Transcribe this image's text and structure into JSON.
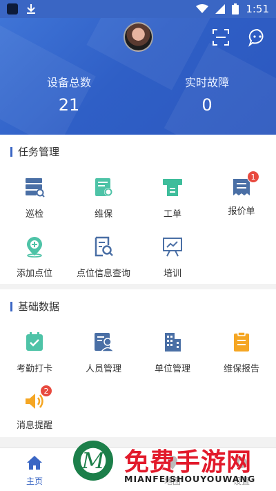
{
  "status_bar": {
    "time": "1:51"
  },
  "header": {
    "stats": [
      {
        "label": "设备总数",
        "value": "21"
      },
      {
        "label": "实时故障",
        "value": "0"
      }
    ]
  },
  "sections": {
    "tasks": {
      "title": "任务管理",
      "items": [
        {
          "label": "巡检",
          "icon": "inspection-icon",
          "color": "#4a6fa5"
        },
        {
          "label": "维保",
          "icon": "maintenance-icon",
          "color": "#4ec3a7"
        },
        {
          "label": "工单",
          "icon": "work-order-icon",
          "color": "#3ebd9b"
        },
        {
          "label": "报价单",
          "icon": "quotation-icon",
          "color": "#4a6fa5",
          "badge": "1"
        },
        {
          "label": "添加点位",
          "icon": "add-location-icon",
          "color": "#4ec3a7"
        },
        {
          "label": "点位信息查询",
          "icon": "location-query-icon",
          "color": "#4a6fa5"
        },
        {
          "label": "培训",
          "icon": "training-icon",
          "color": "#4a6fa5"
        }
      ]
    },
    "basic": {
      "title": "基础数据",
      "items": [
        {
          "label": "考勤打卡",
          "icon": "attendance-icon",
          "color": "#4ec3a7"
        },
        {
          "label": "人员管理",
          "icon": "personnel-icon",
          "color": "#4a6fa5"
        },
        {
          "label": "单位管理",
          "icon": "building-icon",
          "color": "#4a6fa5"
        },
        {
          "label": "维保报告",
          "icon": "report-icon",
          "color": "#f5a623"
        },
        {
          "label": "消息提醒",
          "icon": "speaker-icon",
          "color": "#f5a623",
          "badge": "2"
        }
      ]
    }
  },
  "bottom_nav": [
    {
      "label": "主页",
      "icon": "home-icon",
      "active": true
    },
    {
      "label": "地图",
      "icon": "map-icon",
      "active": false
    },
    {
      "label": "设置",
      "icon": "settings-icon",
      "active": false
    }
  ],
  "watermark": {
    "logo_letter": "M",
    "title": "免费手游网",
    "subtitle": "MIANFEISHOUYOUWANG"
  },
  "colors": {
    "primary": "#3a66c4",
    "badge": "#e84a3f",
    "watermark_red": "#e21a2b",
    "watermark_green": "#1c7f4a"
  }
}
